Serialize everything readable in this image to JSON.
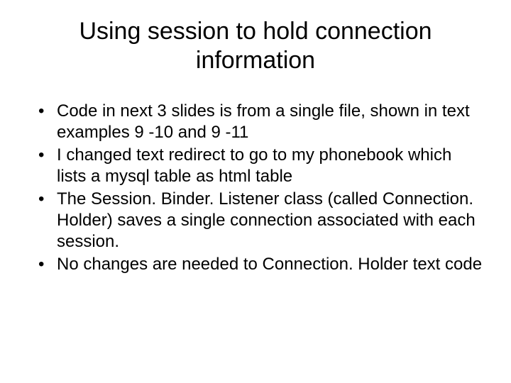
{
  "slide": {
    "title": "Using session to hold connection information",
    "bullets": [
      "Code in next 3 slides is from a single file, shown in text examples 9 -10 and 9 -11",
      "I changed text redirect to go to my phonebook which lists a mysql table as html table",
      "The Session. Binder. Listener class (called Connection. Holder) saves a single connection associated with each session.",
      "No changes are needed to Connection. Holder text code"
    ]
  }
}
